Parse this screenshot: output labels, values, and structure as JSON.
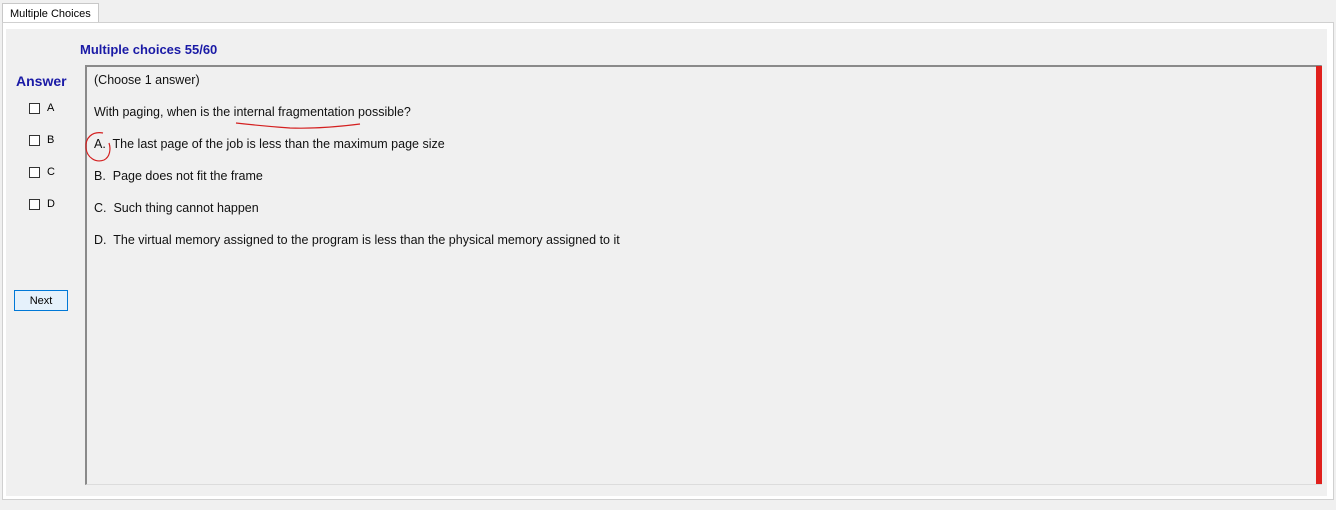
{
  "tab": {
    "label": "Multiple Choices"
  },
  "header": {
    "title": "Multiple choices 55/60"
  },
  "answer_panel": {
    "heading": "Answer",
    "options": [
      {
        "label": "A",
        "checked": false
      },
      {
        "label": "B",
        "checked": false
      },
      {
        "label": "C",
        "checked": false
      },
      {
        "label": "D",
        "checked": false
      }
    ],
    "next_label": "Next"
  },
  "question": {
    "instruction": "(Choose 1 answer)",
    "text": "With paging, when is the internal fragmentation possible?",
    "choices": [
      {
        "letter": "A.",
        "text": "The last page of the job is less than the maximum page size"
      },
      {
        "letter": "B.",
        "text": "Page does not fit the frame"
      },
      {
        "letter": "C.",
        "text": "Such thing cannot happen"
      },
      {
        "letter": "D.",
        "text": "The virtual memory assigned to the program is less than the physical memory assigned to it"
      }
    ]
  },
  "colors": {
    "accent": "#1a1aa6",
    "highlight_bar": "#e0201c",
    "annotation": "#d42020"
  }
}
